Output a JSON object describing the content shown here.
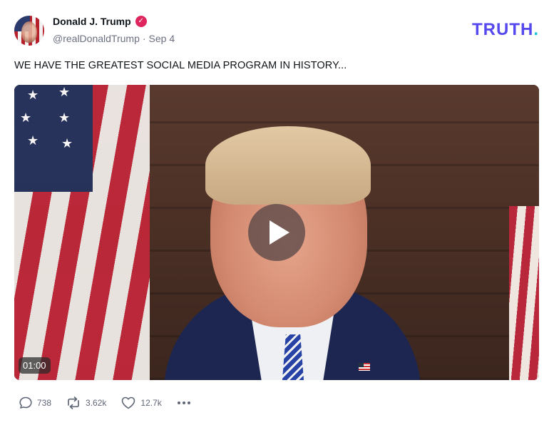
{
  "author": {
    "display_name": "Donald J. Trump",
    "handle": "@realDonaldTrump",
    "separator": "·",
    "date": "Sep 4",
    "verified": true
  },
  "brand": {
    "logo_text": "TRUTH",
    "logo_dot": ".",
    "color": "#5448ee",
    "dot_color": "#19c5d6"
  },
  "post": {
    "text": "WE HAVE THE GREATEST SOCIAL MEDIA PROGRAM IN HISTORY..."
  },
  "video": {
    "duration": "01:00"
  },
  "actions": {
    "replies": "738",
    "retruths": "3.62k",
    "likes": "12.7k"
  },
  "colors": {
    "verified_badge": "#e0245e",
    "muted_text": "#6b6f80"
  }
}
